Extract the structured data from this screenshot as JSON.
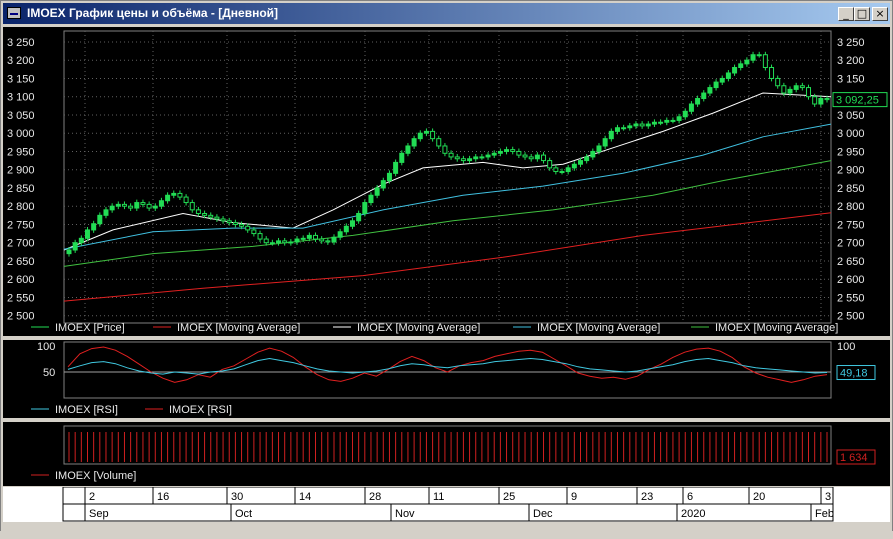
{
  "window": {
    "title": "IMOEX График цены и объёма - [Дневной]",
    "minimize_glyph": "_",
    "maximize_glyph": "□",
    "close_glyph": "×"
  },
  "colors": {
    "up": "#22dd55",
    "ma_red": "#e02020",
    "ma_white": "#ffffff",
    "ma_cyan": "#40c0e0",
    "ma_green": "#40c040",
    "rsi_cyan": "#40c8e0",
    "rsi_red": "#e02020",
    "volume": "#d02020",
    "grid": "#606060",
    "axis_text": "#e8e8e8"
  },
  "main_legend": [
    {
      "label": "IMOEX [Price]",
      "color": "#22dd55"
    },
    {
      "label": "IMOEX [Moving Average]",
      "color": "#e02020"
    },
    {
      "label": "IMOEX [Moving Average]",
      "color": "#ffffff"
    },
    {
      "label": "IMOEX [Moving Average]",
      "color": "#40c0e0"
    },
    {
      "label": "IMOEX [Moving Average]",
      "color": "#40c040"
    }
  ],
  "price_labels": [
    "3 250",
    "3 200",
    "3 150",
    "3 100",
    "3 050",
    "3 000",
    "2 950",
    "2 900",
    "2 850",
    "2 800",
    "2 750",
    "2 700",
    "2 650",
    "2 600",
    "2 550",
    "2 500"
  ],
  "price_last_label": "3 092,25",
  "rsi_labels": {
    "left": [
      "100",
      "50"
    ],
    "right": [
      "100"
    ],
    "last": "49,18"
  },
  "rsi_legend": [
    {
      "label": "IMOEX [RSI]",
      "color": "#40c8e0"
    },
    {
      "label": "IMOEX [RSI]",
      "color": "#e02020"
    }
  ],
  "volume_last": "1 634",
  "volume_legend": [
    {
      "label": "IMOEX [Volume]",
      "color": "#d02020"
    }
  ],
  "date_ticks": [
    "2",
    "16",
    "30",
    "14",
    "28",
    "11",
    "25",
    "9",
    "23",
    "6",
    "20",
    "3"
  ],
  "month_labels": [
    "Sep",
    "Oct",
    "Nov",
    "Dec",
    "2020",
    "Feb"
  ],
  "chart_data": {
    "type": "candlestick",
    "ylim": [
      2480,
      3280
    ],
    "date_range": [
      "2019-08-29",
      "2020-02-04"
    ],
    "close": [
      2680,
      2700,
      2712,
      2735,
      2752,
      2775,
      2790,
      2800,
      2805,
      2800,
      2795,
      2810,
      2805,
      2795,
      2800,
      2815,
      2830,
      2835,
      2825,
      2810,
      2790,
      2780,
      2775,
      2770,
      2765,
      2760,
      2755,
      2750,
      2745,
      2735,
      2725,
      2710,
      2700,
      2700,
      2705,
      2700,
      2702,
      2710,
      2712,
      2720,
      2710,
      2705,
      2702,
      2715,
      2730,
      2745,
      2760,
      2780,
      2810,
      2830,
      2850,
      2870,
      2890,
      2920,
      2945,
      2965,
      2985,
      3000,
      3005,
      2985,
      2965,
      2945,
      2935,
      2930,
      2925,
      2930,
      2935,
      2935,
      2940,
      2945,
      2950,
      2955,
      2950,
      2940,
      2935,
      2930,
      2940,
      2925,
      2905,
      2895,
      2895,
      2905,
      2915,
      2925,
      2935,
      2950,
      2965,
      2985,
      3005,
      3015,
      3015,
      3020,
      3025,
      3020,
      3025,
      3030,
      3030,
      3035,
      3035,
      3045,
      3060,
      3080,
      3095,
      3110,
      3125,
      3140,
      3150,
      3165,
      3180,
      3190,
      3200,
      3215,
      3215,
      3180,
      3150,
      3130,
      3110,
      3120,
      3130,
      3125,
      3100,
      3080,
      3095,
      3092
    ],
    "series": [
      {
        "name": "IMOEX [Moving Average]",
        "color": "#e02020",
        "values": [
          2540,
          2780
        ]
      },
      {
        "name": "IMOEX [Moving Average]",
        "color": "#ffffff",
        "values": [
          2680,
          3110
        ]
      },
      {
        "name": "IMOEX [Moving Average]",
        "color": "#40c0e0",
        "values": [
          2680,
          3025
        ]
      },
      {
        "name": "IMOEX [Moving Average]",
        "color": "#40c040",
        "values": [
          2635,
          2925
        ]
      }
    ],
    "rsi_last": 49.18,
    "volume_last": 1634
  }
}
